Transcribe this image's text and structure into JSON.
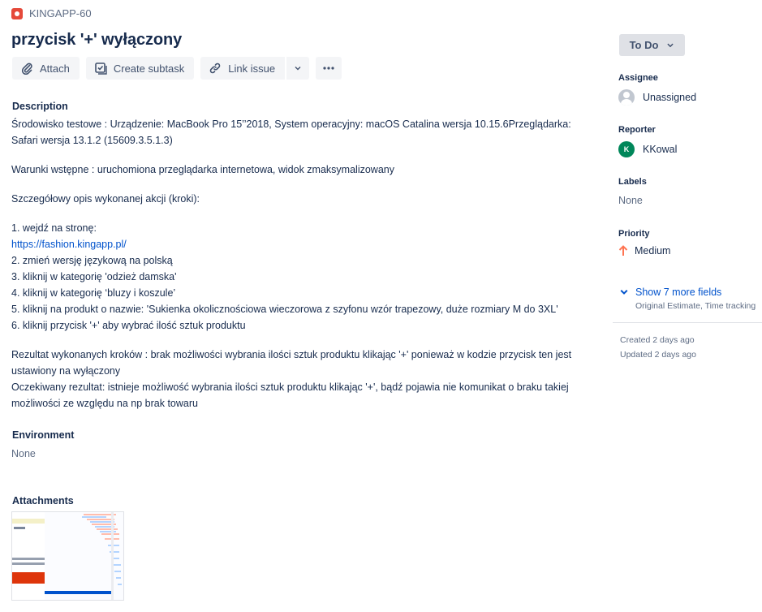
{
  "issue": {
    "key": "KINGAPP-60",
    "title": "przycisk '+' wyłączony"
  },
  "toolbar": {
    "attach_label": "Attach",
    "create_subtask_label": "Create subtask",
    "link_issue_label": "Link issue"
  },
  "description": {
    "heading": "Description",
    "lines": [
      "Środowisko testowe : Urządzenie: MacBook Pro 15’’2018, System operacyjny: macOS Catalina wersja 10.15.6Przeglądarka: Safari wersja 13.1.2 (15609.3.5.1.3)",
      "Warunki wstępne : uruchomiona przeglądarka internetowa, widok zmaksymalizowany",
      "Szczegółowy opis wykonanej akcji (kroki):",
      "1. wejdź na stronę:",
      "https://fashion.kingapp.pl/",
      "2. zmień wersję językową na polską",
      "3. kliknij w kategorię 'odzież damska'",
      "4. kliknij w kategorię ‘bluzy i koszule’",
      "5. kliknij na produkt o nazwie: 'Sukienka okolicznościowa wieczorowa z szyfonu wzór trapezowy, duże rozmiary M do 3XL'",
      "6. kliknij przycisk '+' aby wybrać ilość sztuk produktu",
      "Rezultat wykonanych kroków : brak możliwości wybrania ilości sztuk produktu klikając '+' ponieważ w kodzie przycisk ten jest ustawiony na wyłączony",
      "Oczekiwany rezultat: istnieje możliwość wybrania ilości sztuk produktu klikając '+', bądź pojawia nie komunikat o braku takiej możliwości ze względu na np brak towaru"
    ]
  },
  "environment": {
    "heading": "Environment",
    "value": "None"
  },
  "attachments": {
    "heading": "Attachments"
  },
  "sidebar": {
    "status": "To Do",
    "assignee_label": "Assignee",
    "assignee_value": "Unassigned",
    "reporter_label": "Reporter",
    "reporter_initial": "K",
    "reporter_value": "KKowal",
    "labels_label": "Labels",
    "labels_value": "None",
    "priority_label": "Priority",
    "priority_value": "Medium",
    "more_fields_label": "Show 7 more fields",
    "more_fields_sub": "Original Estimate, Time tracking",
    "created": "Created 2 days ago",
    "updated": "Updated 2 days ago"
  },
  "colors": {
    "bug_icon": "#e5493a",
    "link": "#0052cc",
    "reporter_avatar": "#00875a",
    "priority_medium": "#ff7452"
  },
  "icons": {
    "issue_type": "bug-icon",
    "attach": "paperclip-icon",
    "subtask": "checkbox-icon",
    "link": "link-icon",
    "dropdown": "chevron-down-icon",
    "more": "more-icon",
    "priority": "arrow-up-icon"
  }
}
